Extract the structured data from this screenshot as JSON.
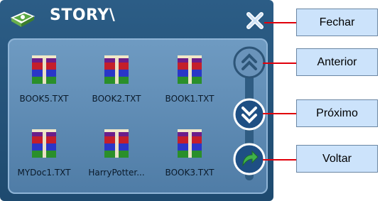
{
  "header": {
    "title": "STORY\\"
  },
  "files": [
    {
      "name": "BOOK5.TXT"
    },
    {
      "name": "BOOK2.TXT"
    },
    {
      "name": "BOOK1.TXT"
    },
    {
      "name": "MYDoc1.TXT"
    },
    {
      "name": "HarryPotter..."
    },
    {
      "name": "BOOK3.TXT"
    }
  ],
  "callouts": {
    "close": "Fechar",
    "previous": "Anterior",
    "next": "Próximo",
    "back": "Voltar"
  },
  "colors": {
    "background": "#2c5d86",
    "panel": "#6f9bc2",
    "callout_bg": "#cce3fb",
    "callout_line": "#e0000b",
    "back_arrow": "#3fb24a"
  },
  "icons": {
    "app": "book-icon",
    "close": "close-icon",
    "previous": "chevron-up-icon",
    "next": "chevron-down-icon",
    "back": "back-arrow-icon",
    "file": "archive-books-icon"
  }
}
